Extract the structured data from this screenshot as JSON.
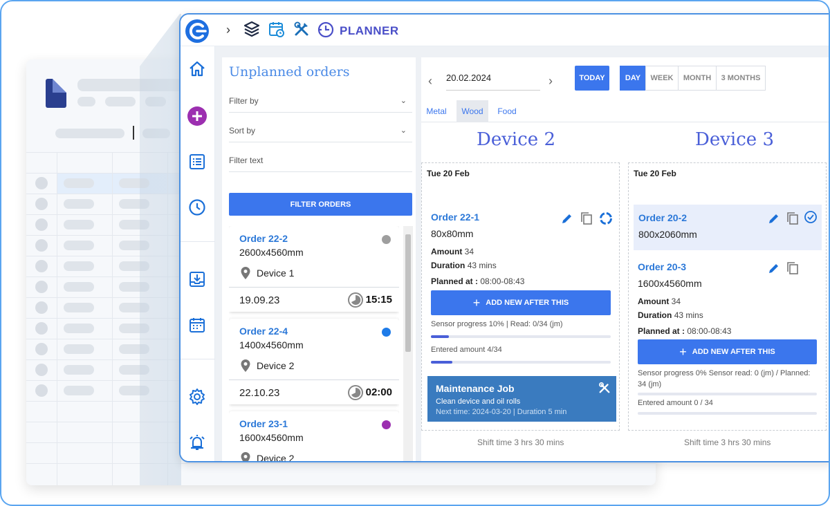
{
  "app": {
    "title": "PLANNER"
  },
  "sidebar_icons": [
    "home-icon",
    "add-circle-icon",
    "list-icon",
    "clock-icon",
    "download-tray-icon",
    "calendar-icon",
    "gear-icon",
    "alarm-icon"
  ],
  "unplanned": {
    "title": "Unplanned orders",
    "filter_by": "Filter by",
    "sort_by": "Sort by",
    "filter_text": "Filter text",
    "filter_button": "FILTER ORDERS",
    "orders": [
      {
        "name": "Order 22-2",
        "dims": "2600x4560mm",
        "device": "Device 1",
        "date": "19.09.23",
        "time": "15:15",
        "color": "#9e9e9e"
      },
      {
        "name": "Order 22-4",
        "dims": "1400x4560mm",
        "device": "Device 2",
        "date": "22.10.23",
        "time": "02:00",
        "color": "#1e7be8"
      },
      {
        "name": "Order 23-1",
        "dims": "1600x4560mm",
        "device": "Device 2",
        "color": "#9c2fb0"
      }
    ]
  },
  "toolbar": {
    "date": "20.02.2024",
    "today": "TODAY",
    "views": [
      "DAY",
      "WEEK",
      "MONTH",
      "3 MONTHS"
    ],
    "active_view": "DAY"
  },
  "tabs": [
    "Metal",
    "Wood",
    "Food"
  ],
  "active_tab": "Wood",
  "devices": [
    {
      "name": "Device 2",
      "day": "Tue 20 Feb",
      "order": {
        "name": "Order 22-1",
        "dims": "80x80mm",
        "amount_label": "Amount",
        "amount": "34",
        "duration_label": "Duration",
        "duration": "43 mins",
        "planned_label": "Planned at :",
        "planned": "08:00-08:43"
      },
      "add_button": "ADD NEW AFTER THIS",
      "sensor": "Sensor progress 10% | Read: 0/34 (jm)",
      "sensor_progress": 0.1,
      "entered": "Entered amount 4/34",
      "entered_progress": 0.1176,
      "maintenance": {
        "title": "Maintenance Job",
        "desc": "Clean device and oil rolls",
        "next": "Next time: 2024-03-20 | Duration 5 min"
      },
      "shift": "Shift time 3 hrs 30 mins"
    },
    {
      "name": "Device 3",
      "day": "Tue 20 Feb",
      "order_top": {
        "name": "Order 20-2",
        "dims": "800x2060mm"
      },
      "order": {
        "name": "Order 20-3",
        "dims": "1600x4560mm",
        "amount_label": "Amount",
        "amount": "34",
        "duration_label": "Duration",
        "duration": "43 mins",
        "planned_label": "Planned at :",
        "planned": "08:00-08:43"
      },
      "add_button": "ADD NEW AFTER THIS",
      "sensor": "Sensor progress 0% Sensor read: 0 (jm) / Planned: 34 (jm)",
      "sensor_progress": 0,
      "entered": "Entered amount 0 / 34",
      "entered_progress": 0,
      "shift": "Shift time 3 hrs 30 mins"
    }
  ],
  "colors": {
    "accent": "#3b76ed",
    "title": "#4a5fd8",
    "link": "#2b78d8",
    "maintenance": "#3a7bbf"
  }
}
